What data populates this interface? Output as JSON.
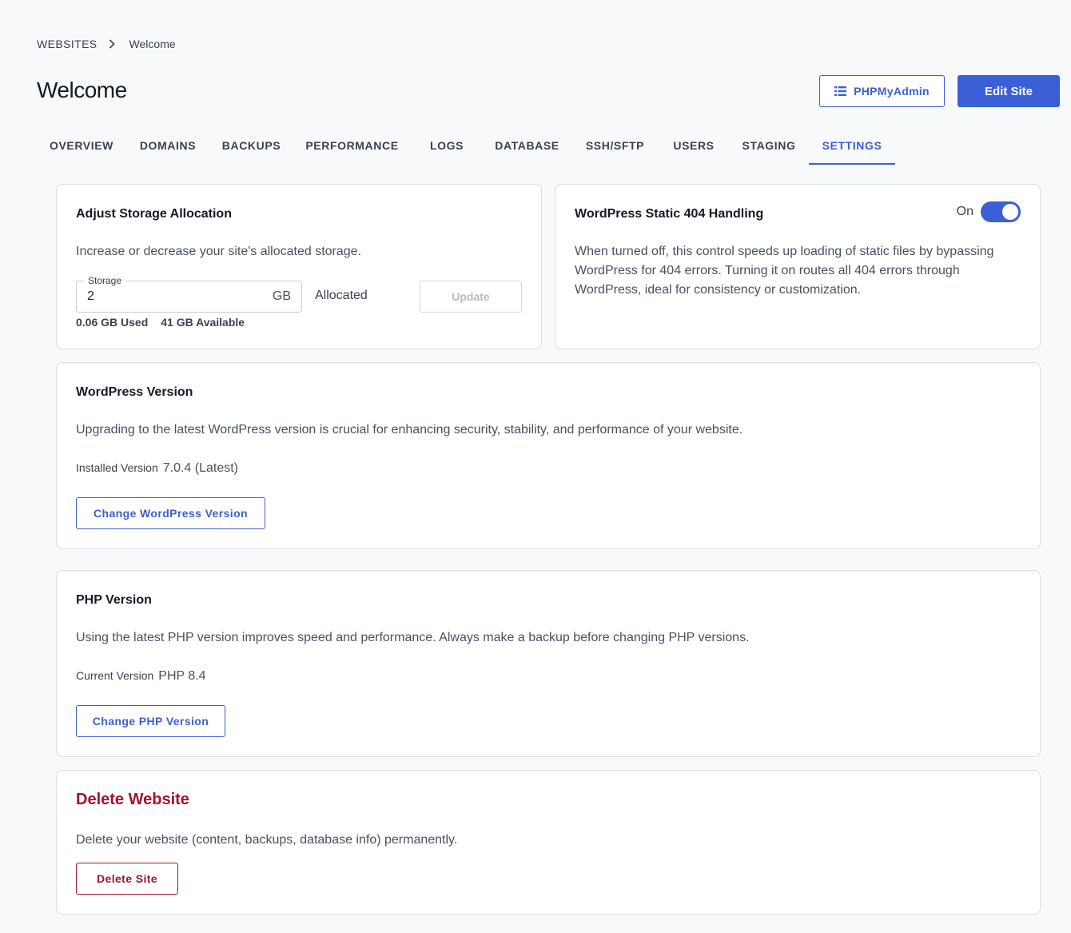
{
  "breadcrumb": {
    "root": "WEBSITES",
    "separator_icon": "chevron-right-icon",
    "current": "Welcome"
  },
  "page_title": "Welcome",
  "header_actions": {
    "phpmyadmin_label": "PHPMyAdmin",
    "phpmyadmin_icon": "database-list-icon",
    "edit_site_label": "Edit Site"
  },
  "tabs": [
    {
      "label": "OVERVIEW",
      "active": false
    },
    {
      "label": "DOMAINS",
      "active": false
    },
    {
      "label": "BACKUPS",
      "active": false
    },
    {
      "label": "PERFORMANCE",
      "active": false
    },
    {
      "label": "LOGS",
      "active": false
    },
    {
      "label": "DATABASE",
      "active": false
    },
    {
      "label": "SSH/SFTP",
      "active": false
    },
    {
      "label": "USERS",
      "active": false
    },
    {
      "label": "STAGING",
      "active": false
    },
    {
      "label": "SETTINGS",
      "active": true
    }
  ],
  "storage": {
    "title": "Adjust Storage Allocation",
    "description": "Increase or decrease your site's allocated storage.",
    "field_label": "Storage",
    "value": "2",
    "unit": "GB",
    "allocated_label": "Allocated",
    "update_label": "Update",
    "used": "0.06 GB Used",
    "available": "41 GB Available"
  },
  "static404": {
    "title": "WordPress Static 404 Handling",
    "toggle_label": "On",
    "toggle_on": true,
    "description": "When turned off, this control speeds up loading of static files by bypassing WordPress for 404 errors. Turning it on routes all 404 errors through WordPress, ideal for consistency or customization."
  },
  "wordpress": {
    "title": "WordPress Version",
    "description": "Upgrading to the latest WordPress version is crucial for enhancing security, stability, and performance of your website.",
    "installed_label": "Installed Version",
    "installed_value": "7.0.4 (Latest)",
    "button_label": "Change WordPress Version"
  },
  "php": {
    "title": "PHP Version",
    "description": "Using the latest PHP version improves speed and performance. Always make a backup before changing PHP versions.",
    "current_label": "Current Version",
    "current_value": "PHP 8.4",
    "button_label": "Change PHP Version"
  },
  "delete": {
    "title": "Delete Website",
    "description": "Delete your website (content, backups, database info) permanently.",
    "button_label": "Delete Site"
  },
  "colors": {
    "accent": "#3b5fd6",
    "danger": "#a0142a",
    "background": "#f8f9fb"
  }
}
